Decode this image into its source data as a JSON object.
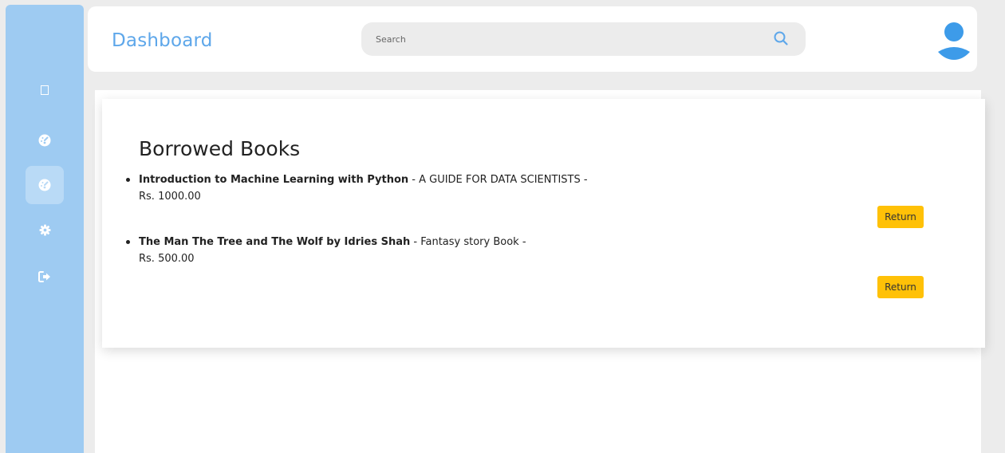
{
  "sidebar": {
    "items": [
      {
        "name": "menu",
        "icon": "square-icon",
        "active": false
      },
      {
        "name": "dashboard",
        "icon": "dashboard-icon",
        "active": false
      },
      {
        "name": "borrowed",
        "icon": "dashboard-icon",
        "active": true
      },
      {
        "name": "settings",
        "icon": "gear-icon",
        "active": false
      },
      {
        "name": "logout",
        "icon": "sign-out-icon",
        "active": false
      }
    ]
  },
  "header": {
    "title": "Dashboard",
    "search": {
      "placeholder": "Search",
      "value": ""
    },
    "avatar_icon": "user-icon"
  },
  "main": {
    "section_title": "Borrowed Books",
    "books": [
      {
        "title": "Introduction to Machine Learning with Python",
        "subtitle": " - A GUIDE FOR DATA SCIENTISTS -",
        "price": "Rs. 1000.00",
        "action_label": "Return"
      },
      {
        "title": "The Man The Tree and The Wolf by Idries Shah",
        "subtitle": " - Fantasy story Book -",
        "price": "Rs. 500.00",
        "action_label": "Return"
      }
    ]
  },
  "colors": {
    "sidebar": "#9ecbf2",
    "accent": "#5ea7ea",
    "button": "#ffc107"
  }
}
